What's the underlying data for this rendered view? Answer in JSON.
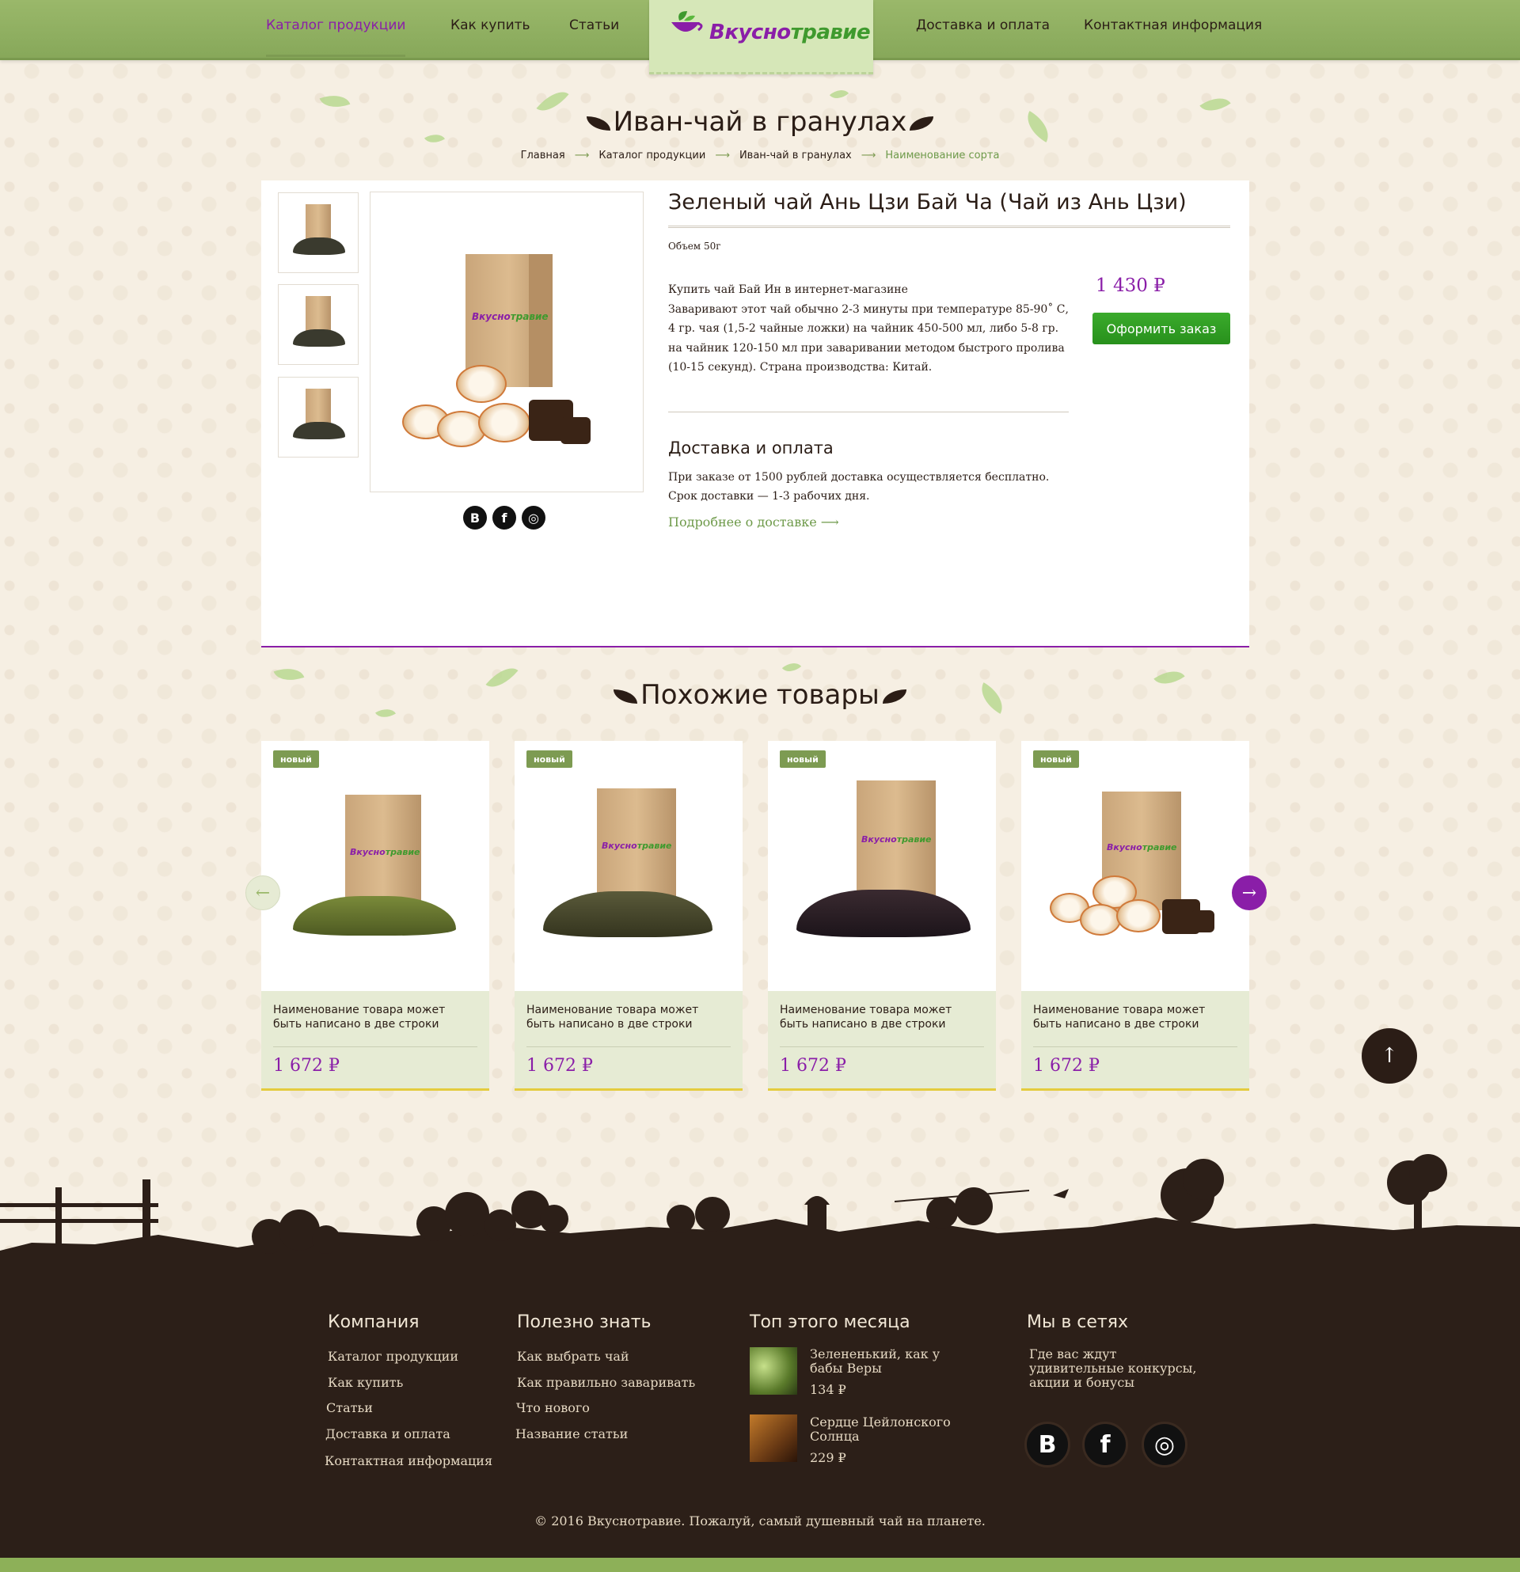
{
  "nav": {
    "left": [
      "Каталог продукции",
      "Как купить",
      "Статьи"
    ],
    "right": [
      "Доставка и оплата",
      "Контактная информация"
    ]
  },
  "logo": {
    "part1": "Вкусно",
    "part2": "травие"
  },
  "page_title": "Иван-чай в гранулах",
  "breadcrumb": [
    "Главная",
    "Каталог продукции",
    "Иван-чай в гранулах",
    "Наименование сорта"
  ],
  "product": {
    "name": "Зеленый чай Ань Цзи Бай Ча (Чай из Ань Цзи)",
    "volume": "Объем 50г",
    "description": "Купить чай Бай Ин в интернет-магазине Заваривают этот чай обычно 2-3 минуты при температуре 85-90˚ С, 4 гр. чая (1,5-2 чайные ложки) на чайник 450-500 мл, либо 5-8 гр. на чайник 120-150 мл при заваривании методом быстрого пролива (10-15 секунд). Страна производства: Китай.",
    "description_line1": "Купить чай Бай Ин в интернет-магазине",
    "description_rest": "Заваривают этот чай обычно 2-3 минуты при температуре 85-90˚ С, 4 гр. чая (1,5-2 чайные ложки) на чайник 450-500 мл, либо 5-8 гр. на чайник 120-150 мл при заваривании методом быстрого пролива (10-15 секунд). Страна производства: Китай.",
    "price": "1 430 ₽",
    "order_button": "Оформить заказ",
    "share": [
      "В",
      "f",
      "◎"
    ]
  },
  "delivery": {
    "title": "Доставка и оплата",
    "line1": "При заказе от 1500 рублей доставка осуществляется бесплатно.",
    "line2": "Срок доставки — 1-3 рабочих дня.",
    "link": "Подробнее о доставке"
  },
  "similar": {
    "title": "Похожие товары",
    "cards": [
      {
        "badge": "новый",
        "name": "Наименование товара может быть написано в две строки",
        "price": "1 672 ₽"
      },
      {
        "badge": "новый",
        "name": "Наименование товара может быть написано в две строки",
        "price": "1 672 ₽"
      },
      {
        "badge": "новый",
        "name": "Наименование товара может быть написано в две строки",
        "price": "1 672 ₽"
      },
      {
        "badge": "новый",
        "name": "Наименование товара может быть написано в две строки",
        "price": "1 672 ₽"
      }
    ],
    "prev": "←",
    "next": "→"
  },
  "to_top": "↑",
  "footer": {
    "company_title": "Компания",
    "company_links": [
      "Каталог продукции",
      "Как купить",
      "Статьи",
      "Доставка и оплата",
      "Контактная информация"
    ],
    "useful_title": "Полезно знать",
    "useful_links": [
      "Как выбрать чай",
      "Как правильно заваривать",
      "Что нового",
      "Название статьи"
    ],
    "top_title": "Топ этого месяца",
    "top_items": [
      {
        "name": "Зелененький, как у бабы Веры",
        "price": "134 ₽"
      },
      {
        "name": "Сердце Цейлонского Солнца",
        "price": "229 ₽"
      }
    ],
    "social_title": "Мы в сетях",
    "social_text": "Где вас ждут удивительные конкурсы, акции и бонусы",
    "social_icons": [
      "В",
      "f",
      "◎"
    ],
    "copyright": "© 2016 Вкуснотравие. Пожалуй, самый душевный чай на планете."
  },
  "colors": {
    "accent": "#8a1ea8",
    "green": "#7d9b52",
    "button": "#2fa024",
    "footer": "#2c1f18"
  }
}
